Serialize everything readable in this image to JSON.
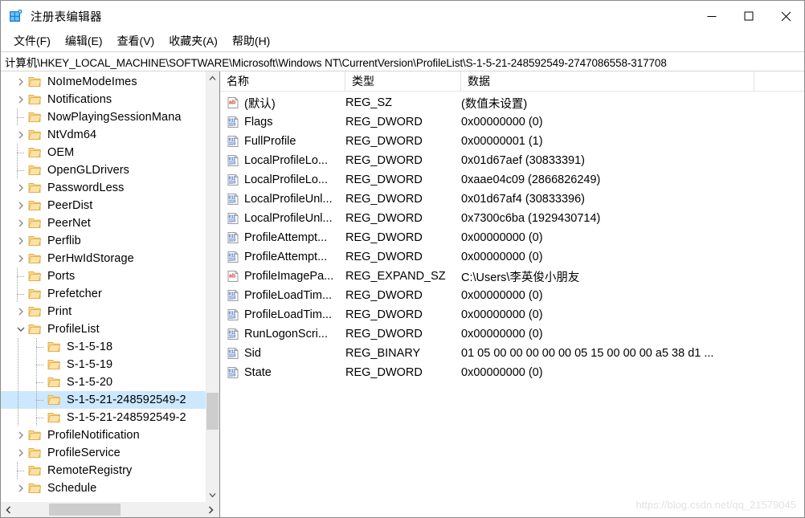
{
  "window": {
    "title": "注册表编辑器",
    "icon": "registry-editor-icon",
    "minimize_label": "—",
    "maximize_label": "□",
    "close_label": "✕"
  },
  "menubar": {
    "items": [
      {
        "label": "文件(F)",
        "name": "menu-file"
      },
      {
        "label": "编辑(E)",
        "name": "menu-edit"
      },
      {
        "label": "查看(V)",
        "name": "menu-view"
      },
      {
        "label": "收藏夹(A)",
        "name": "menu-favorites"
      },
      {
        "label": "帮助(H)",
        "name": "menu-help"
      }
    ]
  },
  "address": {
    "path": "计算机\\HKEY_LOCAL_MACHINE\\SOFTWARE\\Microsoft\\Windows NT\\CurrentVersion\\ProfileList\\S-1-5-21-248592549-2747086558-317708"
  },
  "tree": {
    "items": [
      {
        "label": "NoImeModeImes",
        "indent": 1,
        "marker": "chevron-right",
        "selected": false
      },
      {
        "label": "Notifications",
        "indent": 1,
        "marker": "chevron-right",
        "selected": false
      },
      {
        "label": "NowPlayingSessionMana",
        "indent": 1,
        "marker": "dot",
        "selected": false
      },
      {
        "label": "NtVdm64",
        "indent": 1,
        "marker": "chevron-right",
        "selected": false
      },
      {
        "label": "OEM",
        "indent": 1,
        "marker": "dot",
        "selected": false
      },
      {
        "label": "OpenGLDrivers",
        "indent": 1,
        "marker": "dot",
        "selected": false
      },
      {
        "label": "PasswordLess",
        "indent": 1,
        "marker": "chevron-right",
        "selected": false
      },
      {
        "label": "PeerDist",
        "indent": 1,
        "marker": "chevron-right",
        "selected": false
      },
      {
        "label": "PeerNet",
        "indent": 1,
        "marker": "chevron-right",
        "selected": false
      },
      {
        "label": "Perflib",
        "indent": 1,
        "marker": "chevron-right",
        "selected": false
      },
      {
        "label": "PerHwIdStorage",
        "indent": 1,
        "marker": "chevron-right",
        "selected": false
      },
      {
        "label": "Ports",
        "indent": 1,
        "marker": "dot",
        "selected": false
      },
      {
        "label": "Prefetcher",
        "indent": 1,
        "marker": "dot",
        "selected": false
      },
      {
        "label": "Print",
        "indent": 1,
        "marker": "chevron-right",
        "selected": false
      },
      {
        "label": "ProfileList",
        "indent": 1,
        "marker": "chevron-down",
        "selected": false
      },
      {
        "label": "S-1-5-18",
        "indent": 2,
        "marker": "dot",
        "selected": false
      },
      {
        "label": "S-1-5-19",
        "indent": 2,
        "marker": "dot",
        "selected": false
      },
      {
        "label": "S-1-5-20",
        "indent": 2,
        "marker": "dot",
        "selected": false
      },
      {
        "label": "S-1-5-21-248592549-2",
        "indent": 2,
        "marker": "dot",
        "selected": true
      },
      {
        "label": "S-1-5-21-248592549-2",
        "indent": 2,
        "marker": "dot",
        "selected": false
      },
      {
        "label": "ProfileNotification",
        "indent": 1,
        "marker": "chevron-right",
        "selected": false
      },
      {
        "label": "ProfileService",
        "indent": 1,
        "marker": "chevron-right",
        "selected": false
      },
      {
        "label": "RemoteRegistry",
        "indent": 1,
        "marker": "dot",
        "selected": false
      },
      {
        "label": "Schedule",
        "indent": 1,
        "marker": "chevron-right",
        "selected": false
      }
    ],
    "scroll_up_icon": "chevron-up-icon",
    "scroll_down_icon": "chevron-down-icon",
    "scroll_left_icon": "chevron-left-icon",
    "scroll_right_icon": "chevron-right-icon"
  },
  "list": {
    "columns": [
      {
        "label": "名称",
        "name": "column-header-name"
      },
      {
        "label": "类型",
        "name": "column-header-type"
      },
      {
        "label": "数据",
        "name": "column-header-data"
      }
    ],
    "rows": [
      {
        "icon": "string-value-icon",
        "name": "(默认)",
        "type": "REG_SZ",
        "data": "(数值未设置)"
      },
      {
        "icon": "dword-value-icon",
        "name": "Flags",
        "type": "REG_DWORD",
        "data": "0x00000000 (0)"
      },
      {
        "icon": "dword-value-icon",
        "name": "FullProfile",
        "type": "REG_DWORD",
        "data": "0x00000001 (1)"
      },
      {
        "icon": "dword-value-icon",
        "name": "LocalProfileLo...",
        "type": "REG_DWORD",
        "data": "0x01d67aef (30833391)"
      },
      {
        "icon": "dword-value-icon",
        "name": "LocalProfileLo...",
        "type": "REG_DWORD",
        "data": "0xaae04c09 (2866826249)"
      },
      {
        "icon": "dword-value-icon",
        "name": "LocalProfileUnl...",
        "type": "REG_DWORD",
        "data": "0x01d67af4 (30833396)"
      },
      {
        "icon": "dword-value-icon",
        "name": "LocalProfileUnl...",
        "type": "REG_DWORD",
        "data": "0x7300c6ba (1929430714)"
      },
      {
        "icon": "dword-value-icon",
        "name": "ProfileAttempt...",
        "type": "REG_DWORD",
        "data": "0x00000000 (0)"
      },
      {
        "icon": "dword-value-icon",
        "name": "ProfileAttempt...",
        "type": "REG_DWORD",
        "data": "0x00000000 (0)"
      },
      {
        "icon": "string-value-icon",
        "name": "ProfileImagePa...",
        "type": "REG_EXPAND_SZ",
        "data": "C:\\Users\\李英俊小朋友"
      },
      {
        "icon": "dword-value-icon",
        "name": "ProfileLoadTim...",
        "type": "REG_DWORD",
        "data": "0x00000000 (0)"
      },
      {
        "icon": "dword-value-icon",
        "name": "ProfileLoadTim...",
        "type": "REG_DWORD",
        "data": "0x00000000 (0)"
      },
      {
        "icon": "dword-value-icon",
        "name": "RunLogonScri...",
        "type": "REG_DWORD",
        "data": "0x00000000 (0)"
      },
      {
        "icon": "binary-value-icon",
        "name": "Sid",
        "type": "REG_BINARY",
        "data": "01 05 00 00 00 00 00 05 15 00 00 00 a5 38 d1 ..."
      },
      {
        "icon": "dword-value-icon",
        "name": "State",
        "type": "REG_DWORD",
        "data": "0x00000000 (0)"
      }
    ]
  },
  "watermark": {
    "text": "https://blog.csdn.net/qq_21579045"
  },
  "colors": {
    "selection": "#cce8ff",
    "folder": "#fcd88a",
    "window_border": "#8a8a8a",
    "scrollbar_track": "#f0f0f0",
    "scrollbar_thumb": "#cdcdcd",
    "watermark": "#e2e2e2"
  }
}
